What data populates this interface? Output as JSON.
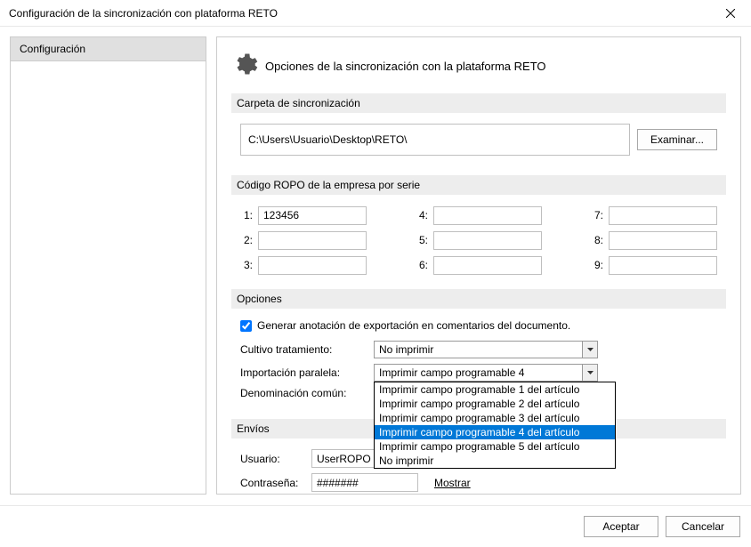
{
  "window": {
    "title": "Configuración de la sincronización con plataforma RETO"
  },
  "sidebar": {
    "items": [
      {
        "label": "Configuración"
      }
    ]
  },
  "header": {
    "title": "Opciones de la sincronización con la plataforma RETO"
  },
  "sections": {
    "folder": {
      "title": "Carpeta de sincronización",
      "path": "C:\\Users\\Usuario\\Desktop\\RETO\\",
      "browse": "Examinar..."
    },
    "ropo": {
      "title": "Código ROPO de la empresa por serie",
      "labels": [
        "1:",
        "2:",
        "3:",
        "4:",
        "5:",
        "6:",
        "7:",
        "8:",
        "9:"
      ],
      "values": [
        "123456",
        "",
        "",
        "",
        "",
        "",
        "",
        "",
        ""
      ]
    },
    "options": {
      "title": "Opciones",
      "checkbox_label": "Generar anotación de exportación en comentarios del documento.",
      "checkbox_checked": true,
      "cultivo_label": "Cultivo tratamiento:",
      "cultivo_value": "No imprimir",
      "paralela_label": "Importación paralela:",
      "paralela_value": "Imprimir campo programable 4",
      "denom_label": "Denominación común:",
      "dropdown_options": [
        "Imprimir campo programable 1 del artículo",
        "Imprimir campo programable 2 del artículo",
        "Imprimir campo programable 3 del artículo",
        "Imprimir campo programable 4 del artículo",
        "Imprimir campo programable 5 del artículo",
        "No imprimir"
      ],
      "dropdown_selected_index": 3
    },
    "envios": {
      "title": "Envíos",
      "user_label": "Usuario:",
      "user_value": "UserROPO",
      "pass_label": "Contraseña:",
      "pass_value": "#######",
      "show_label": "Mostrar"
    }
  },
  "footer": {
    "ok": "Aceptar",
    "cancel": "Cancelar"
  }
}
